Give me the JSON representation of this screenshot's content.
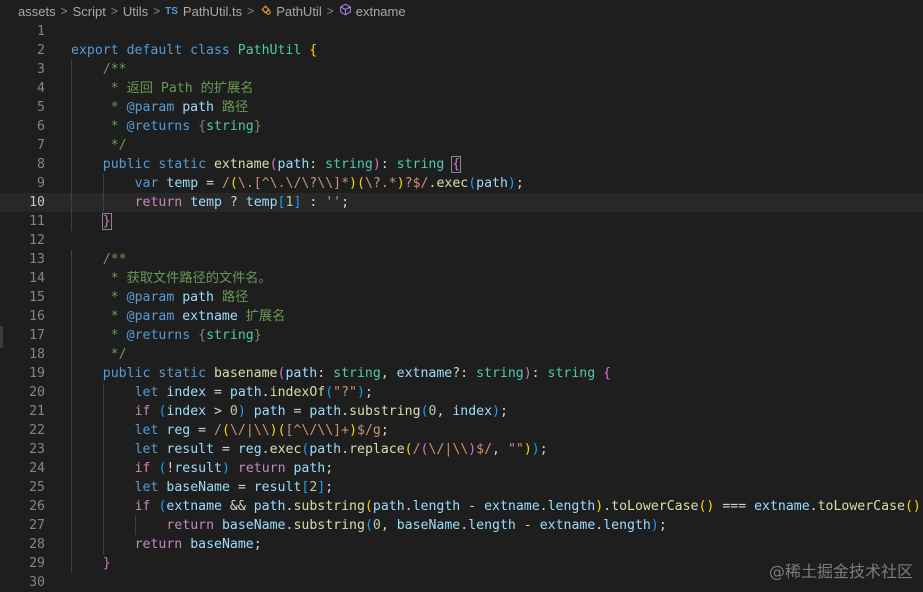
{
  "breadcrumb": {
    "items": [
      "assets",
      "Script",
      "Utils",
      "PathUtil.ts",
      "PathUtil",
      "extname"
    ],
    "separator": ">",
    "ts_badge": "TS"
  },
  "icons": {
    "file": "typescript-file-icon",
    "class": "class-symbol-icon",
    "method": "method-symbol-icon"
  },
  "colors": {
    "background": "#1e1e1e",
    "keyword": "#569cd6",
    "control": "#c586c0",
    "type": "#4ec9b0",
    "function": "#dcdcaa",
    "variable": "#9cdcfe",
    "string": "#ce9178",
    "number": "#b5cea8",
    "comment": "#6a9955"
  },
  "editor": {
    "active_line": 10,
    "lines": [
      {
        "n": "1",
        "indent": 0,
        "tokens": []
      },
      {
        "n": "2",
        "indent": 0,
        "tokens": [
          [
            "kw",
            "export"
          ],
          [
            "plain",
            " "
          ],
          [
            "kw",
            "default"
          ],
          [
            "plain",
            " "
          ],
          [
            "kw",
            "class"
          ],
          [
            "plain",
            " "
          ],
          [
            "cls",
            "PathUtil"
          ],
          [
            "plain",
            " "
          ],
          [
            "b1",
            "{"
          ]
        ]
      },
      {
        "n": "3",
        "indent": 1,
        "tokens": [
          [
            "cmt",
            "/**"
          ]
        ]
      },
      {
        "n": "4",
        "indent": 1,
        "tokens": [
          [
            "cmt",
            " * 返回 Path 的扩展名"
          ]
        ]
      },
      {
        "n": "5",
        "indent": 1,
        "tokens": [
          [
            "cmt",
            " * "
          ],
          [
            "kw",
            "@param"
          ],
          [
            "plain",
            " "
          ],
          [
            "var",
            "path"
          ],
          [
            "cmt",
            " 路径"
          ]
        ]
      },
      {
        "n": "6",
        "indent": 1,
        "tokens": [
          [
            "cmt",
            " * "
          ],
          [
            "kw",
            "@returns"
          ],
          [
            "plain",
            " "
          ],
          [
            "cmt",
            "{"
          ],
          [
            "cls",
            "string"
          ],
          [
            "cmt",
            "}"
          ]
        ]
      },
      {
        "n": "7",
        "indent": 1,
        "tokens": [
          [
            "cmt",
            " */"
          ]
        ]
      },
      {
        "n": "8",
        "indent": 1,
        "tokens": [
          [
            "kw",
            "public"
          ],
          [
            "plain",
            " "
          ],
          [
            "kw",
            "static"
          ],
          [
            "plain",
            " "
          ],
          [
            "fn",
            "extname"
          ],
          [
            "b2",
            "("
          ],
          [
            "var",
            "path"
          ],
          [
            "plain",
            ": "
          ],
          [
            "cls",
            "string"
          ],
          [
            "b2",
            ")"
          ],
          [
            "plain",
            ": "
          ],
          [
            "cls",
            "string"
          ],
          [
            "plain",
            " "
          ],
          [
            "b2m",
            "{"
          ]
        ]
      },
      {
        "n": "9",
        "indent": 2,
        "tokens": [
          [
            "kw",
            "var"
          ],
          [
            "plain",
            " "
          ],
          [
            "var",
            "temp"
          ],
          [
            "plain",
            " = "
          ],
          [
            "str",
            "/"
          ],
          [
            "b1",
            "("
          ],
          [
            "str",
            "\\.[^\\.\\/\\?\\\\]*"
          ],
          [
            "b1",
            ")"
          ],
          [
            "b1",
            "("
          ],
          [
            "str",
            "\\?.*"
          ],
          [
            "b1",
            ")"
          ],
          [
            "str",
            "?$/"
          ],
          [
            "plain",
            "."
          ],
          [
            "fn",
            "exec"
          ],
          [
            "b3",
            "("
          ],
          [
            "var",
            "path"
          ],
          [
            "b3",
            ")"
          ],
          [
            "plain",
            ";"
          ]
        ]
      },
      {
        "n": "10",
        "indent": 2,
        "tokens": [
          [
            "ctl",
            "return"
          ],
          [
            "plain",
            " "
          ],
          [
            "var",
            "temp"
          ],
          [
            "plain",
            " ? "
          ],
          [
            "var",
            "temp"
          ],
          [
            "b3",
            "["
          ],
          [
            "num",
            "1"
          ],
          [
            "b3",
            "]"
          ],
          [
            "plain",
            " : "
          ],
          [
            "str",
            "''"
          ],
          [
            "plain",
            ";"
          ]
        ]
      },
      {
        "n": "11",
        "indent": 1,
        "tokens": [
          [
            "b2m",
            "}"
          ]
        ]
      },
      {
        "n": "12",
        "indent": 0,
        "tokens": []
      },
      {
        "n": "13",
        "indent": 1,
        "tokens": [
          [
            "cmt",
            "/**"
          ]
        ]
      },
      {
        "n": "14",
        "indent": 1,
        "tokens": [
          [
            "cmt",
            " * 获取文件路径的文件名。"
          ]
        ]
      },
      {
        "n": "15",
        "indent": 1,
        "tokens": [
          [
            "cmt",
            " * "
          ],
          [
            "kw",
            "@param"
          ],
          [
            "plain",
            " "
          ],
          [
            "var",
            "path"
          ],
          [
            "cmt",
            " 路径"
          ]
        ]
      },
      {
        "n": "16",
        "indent": 1,
        "tokens": [
          [
            "cmt",
            " * "
          ],
          [
            "kw",
            "@param"
          ],
          [
            "plain",
            " "
          ],
          [
            "var",
            "extname"
          ],
          [
            "cmt",
            " 扩展名"
          ]
        ]
      },
      {
        "n": "17",
        "indent": 1,
        "tokens": [
          [
            "cmt",
            " * "
          ],
          [
            "kw",
            "@returns"
          ],
          [
            "plain",
            " "
          ],
          [
            "cmt",
            "{"
          ],
          [
            "cls",
            "string"
          ],
          [
            "cmt",
            "}"
          ]
        ]
      },
      {
        "n": "18",
        "indent": 1,
        "tokens": [
          [
            "cmt",
            " */"
          ]
        ]
      },
      {
        "n": "19",
        "indent": 1,
        "tokens": [
          [
            "kw",
            "public"
          ],
          [
            "plain",
            " "
          ],
          [
            "kw",
            "static"
          ],
          [
            "plain",
            " "
          ],
          [
            "fn",
            "basename"
          ],
          [
            "b2",
            "("
          ],
          [
            "var",
            "path"
          ],
          [
            "plain",
            ": "
          ],
          [
            "cls",
            "string"
          ],
          [
            "plain",
            ", "
          ],
          [
            "var",
            "extname"
          ],
          [
            "plain",
            "?: "
          ],
          [
            "cls",
            "string"
          ],
          [
            "b2",
            ")"
          ],
          [
            "plain",
            ": "
          ],
          [
            "cls",
            "string"
          ],
          [
            "plain",
            " "
          ],
          [
            "b2",
            "{"
          ]
        ]
      },
      {
        "n": "20",
        "indent": 2,
        "tokens": [
          [
            "kw",
            "let"
          ],
          [
            "plain",
            " "
          ],
          [
            "var",
            "index"
          ],
          [
            "plain",
            " = "
          ],
          [
            "var",
            "path"
          ],
          [
            "plain",
            "."
          ],
          [
            "fn",
            "indexOf"
          ],
          [
            "b3",
            "("
          ],
          [
            "str",
            "\"?\""
          ],
          [
            "b3",
            ")"
          ],
          [
            "plain",
            ";"
          ]
        ]
      },
      {
        "n": "21",
        "indent": 2,
        "tokens": [
          [
            "ctl",
            "if"
          ],
          [
            "plain",
            " "
          ],
          [
            "b3",
            "("
          ],
          [
            "var",
            "index"
          ],
          [
            "plain",
            " > "
          ],
          [
            "num",
            "0"
          ],
          [
            "b3",
            ")"
          ],
          [
            "plain",
            " "
          ],
          [
            "var",
            "path"
          ],
          [
            "plain",
            " = "
          ],
          [
            "var",
            "path"
          ],
          [
            "plain",
            "."
          ],
          [
            "fn",
            "substring"
          ],
          [
            "b3",
            "("
          ],
          [
            "num",
            "0"
          ],
          [
            "plain",
            ", "
          ],
          [
            "var",
            "index"
          ],
          [
            "b3",
            ")"
          ],
          [
            "plain",
            ";"
          ]
        ]
      },
      {
        "n": "22",
        "indent": 2,
        "tokens": [
          [
            "kw",
            "let"
          ],
          [
            "plain",
            " "
          ],
          [
            "var",
            "reg"
          ],
          [
            "plain",
            " = "
          ],
          [
            "str",
            "/"
          ],
          [
            "b1",
            "("
          ],
          [
            "str",
            "\\/|\\\\"
          ],
          [
            "b1",
            ")"
          ],
          [
            "b1",
            "("
          ],
          [
            "str",
            "[^\\/\\\\]+"
          ],
          [
            "b1",
            ")"
          ],
          [
            "str",
            "$/g"
          ],
          [
            "plain",
            ";"
          ]
        ]
      },
      {
        "n": "23",
        "indent": 2,
        "tokens": [
          [
            "kw",
            "let"
          ],
          [
            "plain",
            " "
          ],
          [
            "var",
            "result"
          ],
          [
            "plain",
            " = "
          ],
          [
            "var",
            "reg"
          ],
          [
            "plain",
            "."
          ],
          [
            "fn",
            "exec"
          ],
          [
            "b3",
            "("
          ],
          [
            "var",
            "path"
          ],
          [
            "plain",
            "."
          ],
          [
            "fn",
            "replace"
          ],
          [
            "b1",
            "("
          ],
          [
            "str",
            "/"
          ],
          [
            "b2",
            "("
          ],
          [
            "str",
            "\\/|\\\\"
          ],
          [
            "b2",
            ")"
          ],
          [
            "str",
            "$/"
          ],
          [
            "plain",
            ", "
          ],
          [
            "str",
            "\"\""
          ],
          [
            "b1",
            ")"
          ],
          [
            "b3",
            ")"
          ],
          [
            "plain",
            ";"
          ]
        ]
      },
      {
        "n": "24",
        "indent": 2,
        "tokens": [
          [
            "ctl",
            "if"
          ],
          [
            "plain",
            " "
          ],
          [
            "b3",
            "("
          ],
          [
            "plain",
            "!"
          ],
          [
            "var",
            "result"
          ],
          [
            "b3",
            ")"
          ],
          [
            "plain",
            " "
          ],
          [
            "ctl",
            "return"
          ],
          [
            "plain",
            " "
          ],
          [
            "var",
            "path"
          ],
          [
            "plain",
            ";"
          ]
        ]
      },
      {
        "n": "25",
        "indent": 2,
        "tokens": [
          [
            "kw",
            "let"
          ],
          [
            "plain",
            " "
          ],
          [
            "var",
            "baseName"
          ],
          [
            "plain",
            " = "
          ],
          [
            "var",
            "result"
          ],
          [
            "b3",
            "["
          ],
          [
            "num",
            "2"
          ],
          [
            "b3",
            "]"
          ],
          [
            "plain",
            ";"
          ]
        ]
      },
      {
        "n": "26",
        "indent": 2,
        "tokens": [
          [
            "ctl",
            "if"
          ],
          [
            "plain",
            " "
          ],
          [
            "b3",
            "("
          ],
          [
            "var",
            "extname"
          ],
          [
            "plain",
            " && "
          ],
          [
            "var",
            "path"
          ],
          [
            "plain",
            "."
          ],
          [
            "fn",
            "substring"
          ],
          [
            "b1",
            "("
          ],
          [
            "var",
            "path"
          ],
          [
            "plain",
            "."
          ],
          [
            "var",
            "length"
          ],
          [
            "plain",
            " - "
          ],
          [
            "var",
            "extname"
          ],
          [
            "plain",
            "."
          ],
          [
            "var",
            "length"
          ],
          [
            "b1",
            ")"
          ],
          [
            "plain",
            "."
          ],
          [
            "fn",
            "toLowerCase"
          ],
          [
            "b1",
            "()"
          ],
          [
            "plain",
            " === "
          ],
          [
            "var",
            "extname"
          ],
          [
            "plain",
            "."
          ],
          [
            "fn",
            "toLowerCase"
          ],
          [
            "b1",
            "()"
          ],
          [
            "b3",
            ")"
          ]
        ]
      },
      {
        "n": "27",
        "indent": 3,
        "tokens": [
          [
            "ctl",
            "return"
          ],
          [
            "plain",
            " "
          ],
          [
            "var",
            "baseName"
          ],
          [
            "plain",
            "."
          ],
          [
            "fn",
            "substring"
          ],
          [
            "b3",
            "("
          ],
          [
            "num",
            "0"
          ],
          [
            "plain",
            ", "
          ],
          [
            "var",
            "baseName"
          ],
          [
            "plain",
            "."
          ],
          [
            "var",
            "length"
          ],
          [
            "plain",
            " - "
          ],
          [
            "var",
            "extname"
          ],
          [
            "plain",
            "."
          ],
          [
            "var",
            "length"
          ],
          [
            "b3",
            ")"
          ],
          [
            "plain",
            ";"
          ]
        ]
      },
      {
        "n": "28",
        "indent": 2,
        "tokens": [
          [
            "ctl",
            "return"
          ],
          [
            "plain",
            " "
          ],
          [
            "var",
            "baseName"
          ],
          [
            "plain",
            ";"
          ]
        ]
      },
      {
        "n": "29",
        "indent": 1,
        "tokens": [
          [
            "b2",
            "}"
          ]
        ]
      },
      {
        "n": "30",
        "indent": 0,
        "tokens": []
      }
    ]
  },
  "watermark": "@稀土掘金技术社区"
}
